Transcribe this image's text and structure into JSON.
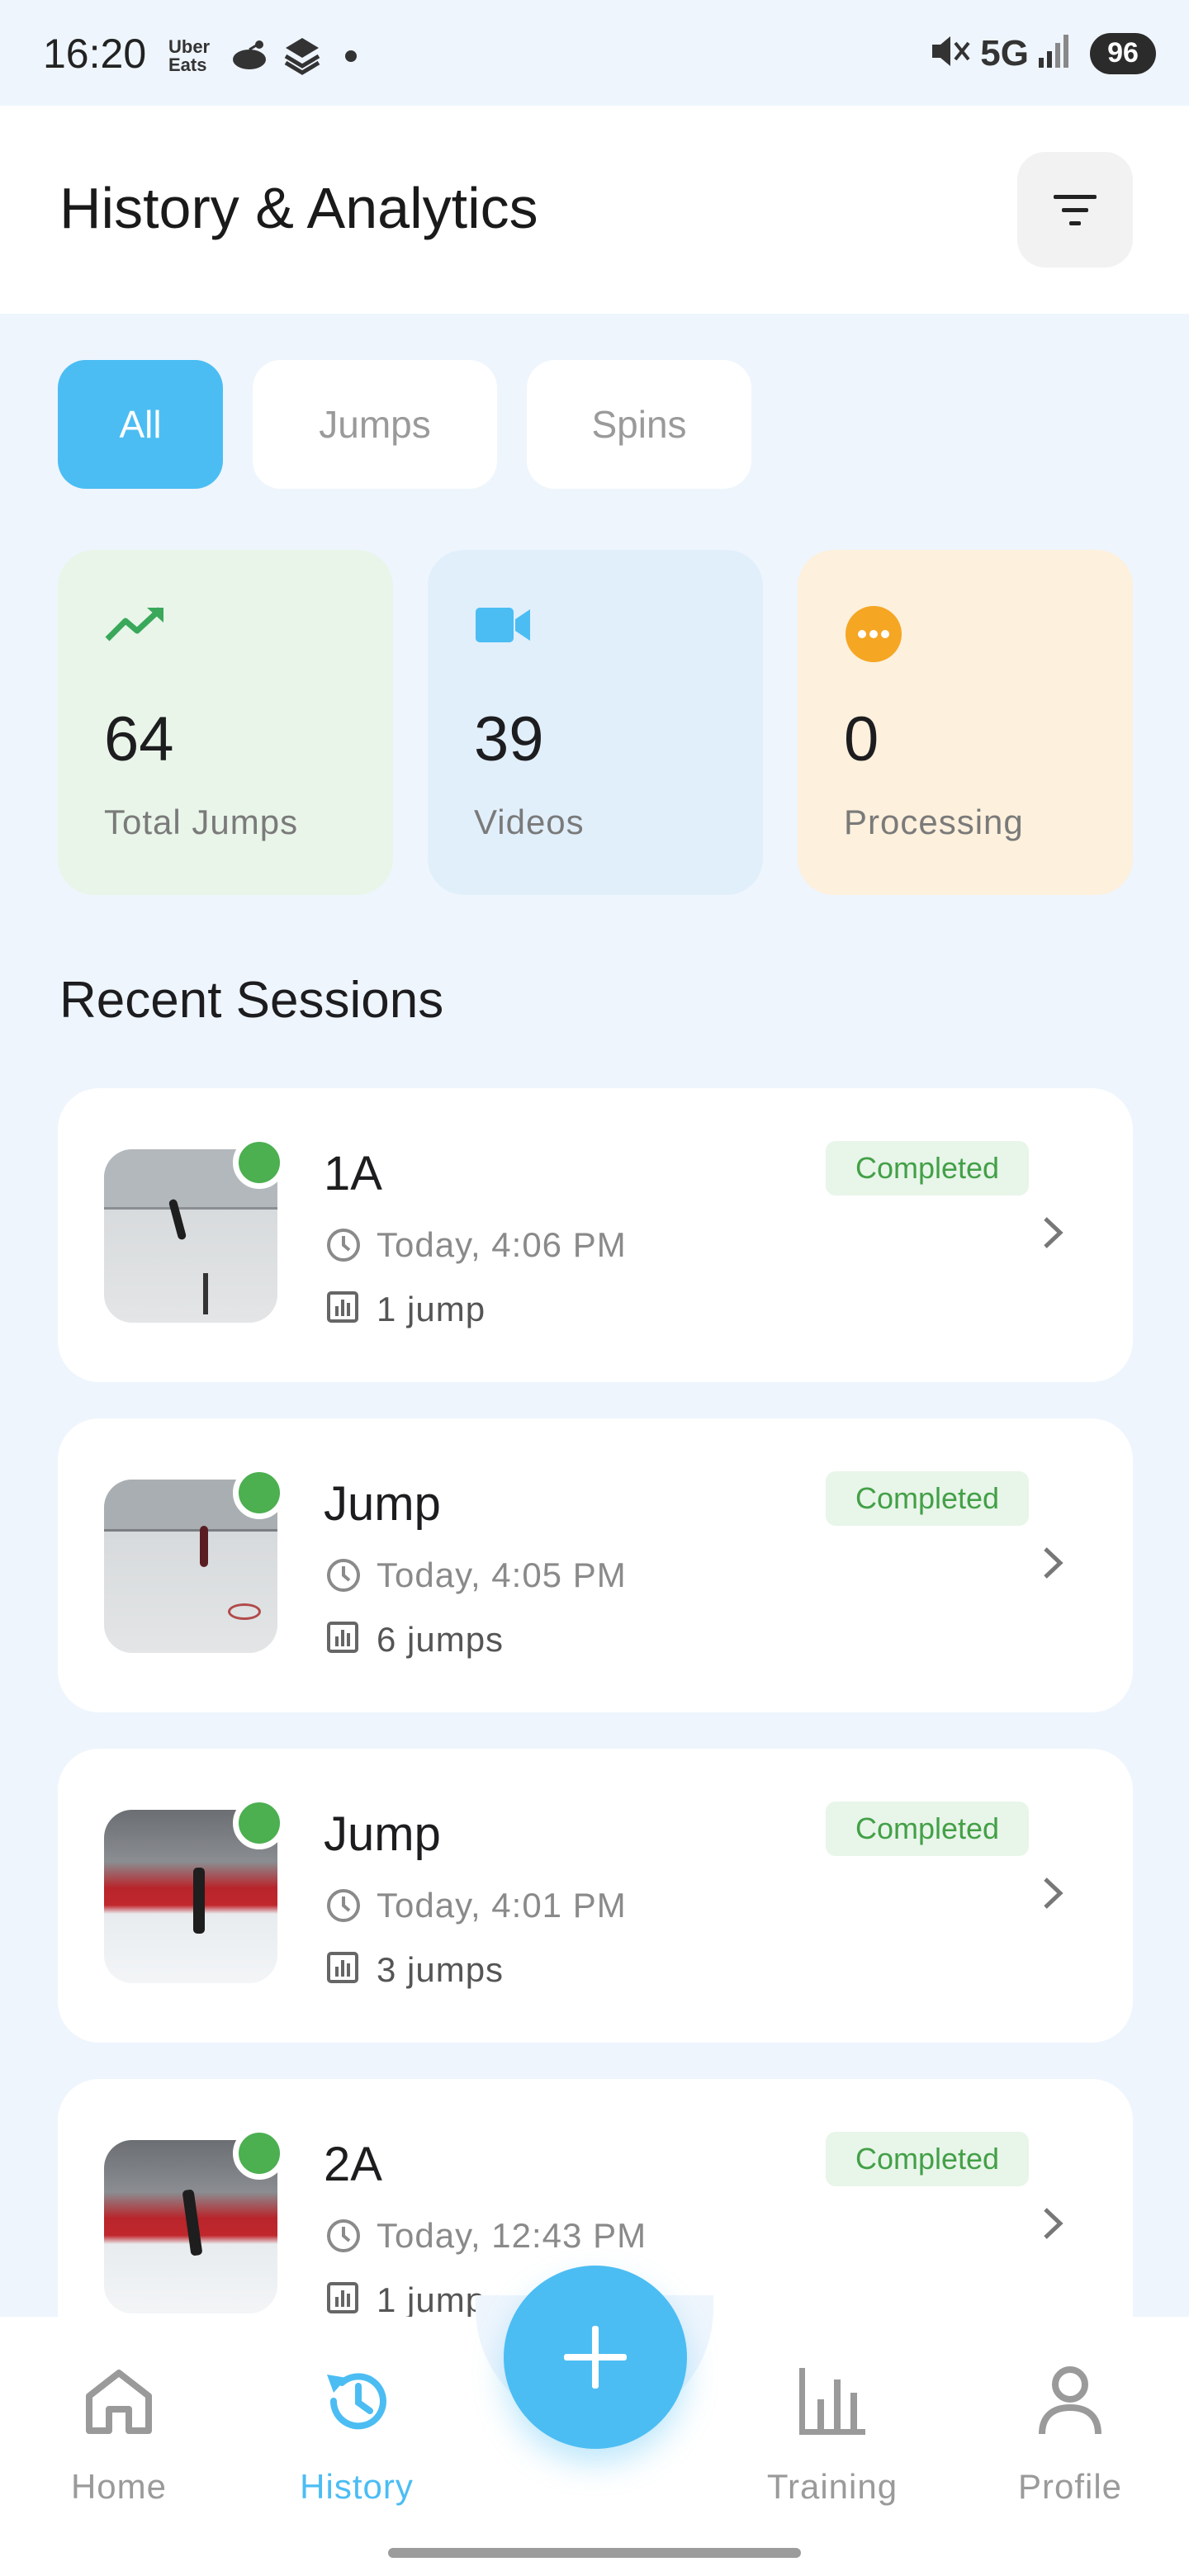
{
  "status_bar": {
    "time": "16:20",
    "uber_eats_label": "Uber\nEats",
    "network": "5G",
    "battery": "96"
  },
  "header": {
    "title": "History & Analytics",
    "filter_icon": "filter-icon"
  },
  "tabs": [
    {
      "label": "All",
      "active": true
    },
    {
      "label": "Jumps",
      "active": false
    },
    {
      "label": "Spins",
      "active": false
    }
  ],
  "stats": [
    {
      "value": "64",
      "label": "Total Jumps",
      "icon": "trending-up-icon",
      "color": "#3aa85a"
    },
    {
      "value": "39",
      "label": "Videos",
      "icon": "video-camera-icon",
      "color": "#4bbdf3"
    },
    {
      "value": "0",
      "label": "Processing",
      "icon": "more-dots-icon",
      "color": "#f5a623"
    }
  ],
  "recent_sessions": {
    "title": "Recent Sessions",
    "items": [
      {
        "name": "1A",
        "time": "Today, 4:06 PM",
        "count": "1 jump",
        "status": "Completed"
      },
      {
        "name": "Jump",
        "time": "Today, 4:05 PM",
        "count": "6 jumps",
        "status": "Completed"
      },
      {
        "name": "Jump",
        "time": "Today, 4:01 PM",
        "count": "3 jumps",
        "status": "Completed"
      },
      {
        "name": "2A",
        "time": "Today, 12:43 PM",
        "count": "1 jump",
        "status": "Completed"
      }
    ]
  },
  "bottom_nav": {
    "items": [
      {
        "label": "Home",
        "icon": "home-icon",
        "active": false
      },
      {
        "label": "History",
        "icon": "history-icon",
        "active": true
      },
      {
        "label": "Training",
        "icon": "bar-chart-icon",
        "active": false
      },
      {
        "label": "Profile",
        "icon": "person-icon",
        "active": false
      }
    ],
    "fab_icon": "plus-icon"
  },
  "colors": {
    "accent": "#4bbdf3",
    "success": "#43a047",
    "background": "#eef5fd"
  }
}
